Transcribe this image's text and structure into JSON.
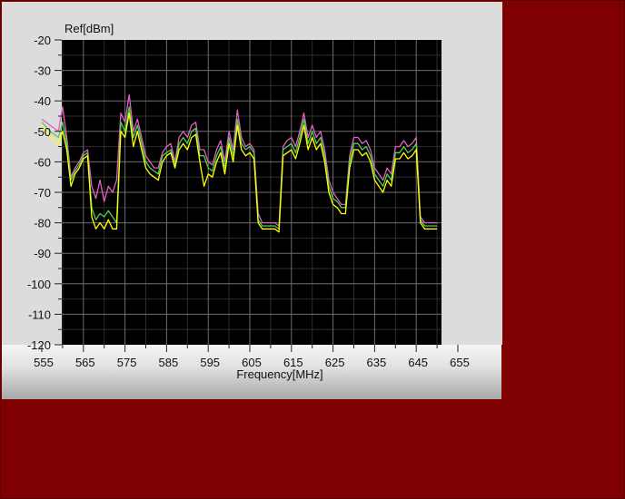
{
  "chart_data": {
    "type": "line",
    "ylabel": "Ref[dBm]",
    "xlabel": "Frequency[MHz]",
    "xlim": [
      555,
      655
    ],
    "ylim": [
      -120,
      -20
    ],
    "x_ticks": [
      555,
      565,
      575,
      585,
      595,
      605,
      615,
      625,
      635,
      645,
      655
    ],
    "x_tick_labels": [
      "555",
      "565",
      "575",
      "585",
      "595",
      "605",
      "615",
      "625",
      "635",
      "645",
      "655"
    ],
    "y_ticks": [
      -20,
      -30,
      -40,
      -50,
      -60,
      -70,
      -80,
      -90,
      -100,
      -110,
      -120
    ],
    "y_tick_labels": [
      "-20",
      "-30",
      "-40",
      "-50",
      "-60",
      "-70",
      "-80",
      "-90",
      "-100",
      "-110",
      "-120"
    ],
    "plot_background": "#000000",
    "grid_color": "#6e6e6e",
    "grid": true,
    "series": [
      {
        "color": "#e060c0",
        "x": [
          555,
          557,
          559,
          560,
          561,
          562,
          563,
          564,
          565,
          566,
          567,
          568,
          569,
          570,
          571,
          572,
          573,
          574,
          575,
          576,
          577,
          578,
          579,
          580,
          581,
          582,
          583,
          584,
          585,
          586,
          587,
          588,
          589,
          590,
          591,
          592,
          593,
          594,
          595,
          596,
          597,
          598,
          599,
          600,
          601,
          602,
          603,
          604,
          605,
          606,
          607,
          608,
          609,
          610,
          611,
          612,
          613,
          614,
          615,
          616,
          617,
          618,
          619,
          620,
          621,
          622,
          623,
          624,
          625,
          626,
          627,
          628,
          629,
          630,
          631,
          632,
          633,
          634,
          635,
          636,
          637,
          638,
          639,
          640,
          641,
          642,
          643,
          644,
          645,
          646,
          647,
          648,
          649,
          650
        ],
        "y": [
          -46,
          -48,
          -50,
          -42,
          -52,
          -65,
          -62,
          -60,
          -57,
          -56,
          -68,
          -72,
          -66,
          -73,
          -68,
          -70,
          -66,
          -44,
          -47,
          -38,
          -50,
          -46,
          -52,
          -58,
          -60,
          -62,
          -62,
          -57,
          -55,
          -54,
          -60,
          -52,
          -50,
          -52,
          -48,
          -47,
          -56,
          -56,
          -60,
          -61,
          -56,
          -53,
          -60,
          -50,
          -56,
          -43,
          -52,
          -55,
          -54,
          -56,
          -77,
          -80,
          -80,
          -80,
          -80,
          -81,
          -55,
          -53,
          -52,
          -55,
          -50,
          -44,
          -52,
          -48,
          -52,
          -50,
          -56,
          -66,
          -70,
          -72,
          -74,
          -74,
          -58,
          -52,
          -52,
          -54,
          -53,
          -56,
          -62,
          -64,
          -66,
          -62,
          -64,
          -55,
          -55,
          -53,
          -55,
          -54,
          -52,
          -78,
          -80,
          -80,
          -80,
          -80
        ]
      },
      {
        "color": "#50d050",
        "x": [
          555,
          557,
          559,
          560,
          561,
          562,
          563,
          564,
          565,
          566,
          567,
          568,
          569,
          570,
          571,
          572,
          573,
          574,
          575,
          576,
          577,
          578,
          579,
          580,
          581,
          582,
          583,
          584,
          585,
          586,
          587,
          588,
          589,
          590,
          591,
          592,
          593,
          594,
          595,
          596,
          597,
          598,
          599,
          600,
          601,
          602,
          603,
          604,
          605,
          606,
          607,
          608,
          609,
          610,
          611,
          612,
          613,
          614,
          615,
          616,
          617,
          618,
          619,
          620,
          621,
          622,
          623,
          624,
          625,
          626,
          627,
          628,
          629,
          630,
          631,
          632,
          633,
          634,
          635,
          636,
          637,
          638,
          639,
          640,
          641,
          642,
          643,
          644,
          645,
          646,
          647,
          648,
          649,
          650
        ],
        "y": [
          -47,
          -50,
          -52,
          -47,
          -54,
          -66,
          -63,
          -61,
          -58,
          -57,
          -75,
          -79,
          -77,
          -78,
          -76,
          -78,
          -80,
          -47,
          -50,
          -42,
          -52,
          -48,
          -54,
          -60,
          -62,
          -63,
          -64,
          -58,
          -57,
          -56,
          -61,
          -54,
          -52,
          -54,
          -50,
          -49,
          -58,
          -58,
          -62,
          -63,
          -58,
          -55,
          -62,
          -52,
          -58,
          -46,
          -54,
          -56,
          -55,
          -57,
          -79,
          -81,
          -81,
          -81,
          -81,
          -82,
          -56,
          -55,
          -54,
          -57,
          -52,
          -46,
          -54,
          -50,
          -54,
          -52,
          -58,
          -68,
          -72,
          -73,
          -75,
          -75,
          -60,
          -54,
          -54,
          -56,
          -55,
          -58,
          -64,
          -66,
          -68,
          -64,
          -66,
          -57,
          -57,
          -55,
          -57,
          -56,
          -54,
          -79,
          -81,
          -81,
          -81,
          -81
        ]
      },
      {
        "color": "#ffff00",
        "x": [
          555,
          557,
          559,
          560,
          561,
          562,
          563,
          564,
          565,
          566,
          567,
          568,
          569,
          570,
          571,
          572,
          573,
          574,
          575,
          576,
          577,
          578,
          579,
          580,
          581,
          582,
          583,
          584,
          585,
          586,
          587,
          588,
          589,
          590,
          591,
          592,
          593,
          594,
          595,
          596,
          597,
          598,
          599,
          600,
          601,
          602,
          603,
          604,
          605,
          606,
          607,
          608,
          609,
          610,
          611,
          612,
          613,
          614,
          615,
          616,
          617,
          618,
          619,
          620,
          621,
          622,
          623,
          624,
          625,
          626,
          627,
          628,
          629,
          630,
          631,
          632,
          633,
          634,
          635,
          636,
          637,
          638,
          639,
          640,
          641,
          642,
          643,
          644,
          645,
          646,
          647,
          648,
          649,
          650
        ],
        "y": [
          -48,
          -52,
          -54,
          -50,
          -56,
          -68,
          -64,
          -62,
          -59,
          -58,
          -78,
          -82,
          -80,
          -82,
          -79,
          -82,
          -82,
          -50,
          -52,
          -44,
          -55,
          -50,
          -56,
          -62,
          -64,
          -65,
          -66,
          -60,
          -58,
          -57,
          -62,
          -56,
          -54,
          -56,
          -52,
          -51,
          -60,
          -68,
          -64,
          -65,
          -60,
          -57,
          -64,
          -54,
          -60,
          -48,
          -56,
          -58,
          -57,
          -59,
          -80,
          -82,
          -82,
          -82,
          -82,
          -83,
          -58,
          -57,
          -56,
          -59,
          -54,
          -48,
          -56,
          -52,
          -56,
          -54,
          -60,
          -70,
          -74,
          -75,
          -77,
          -77,
          -62,
          -56,
          -56,
          -58,
          -57,
          -60,
          -66,
          -68,
          -70,
          -66,
          -68,
          -59,
          -59,
          -57,
          -59,
          -58,
          -56,
          -80,
          -82,
          -82,
          -82,
          -82
        ]
      }
    ]
  }
}
